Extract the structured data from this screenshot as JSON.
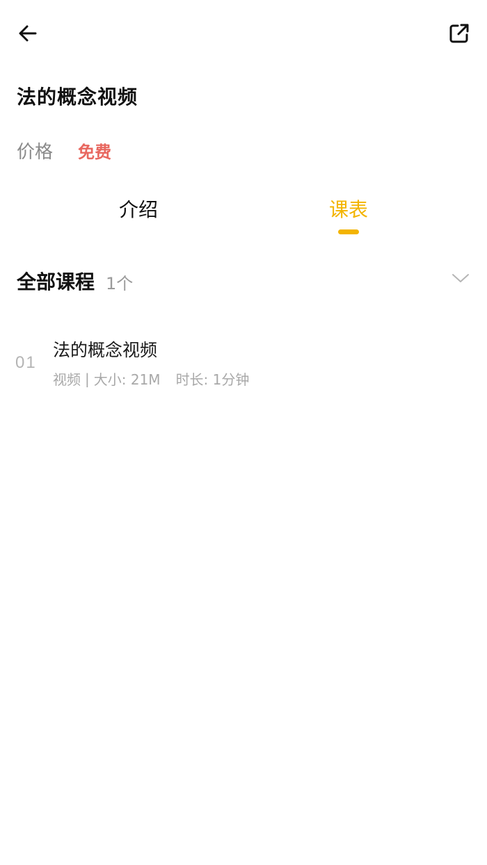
{
  "header": {
    "back_icon": "arrow-left-icon",
    "share_icon": "external-share-icon"
  },
  "course": {
    "title": "法的概念视频",
    "price_label": "价格",
    "price_value": "免费"
  },
  "tabs": [
    {
      "label": "介绍",
      "active": false
    },
    {
      "label": "课表",
      "active": true
    }
  ],
  "section": {
    "title": "全部课程",
    "count": "1个",
    "expand_icon": "chevron-down-icon"
  },
  "lessons": [
    {
      "index": "01",
      "title": "法的概念视频",
      "type": "视频",
      "size": "大小: 21M",
      "duration": "时长: 1分钟"
    }
  ],
  "colors": {
    "accent": "#f3b400",
    "price": "#e8675f",
    "muted": "#a8a8a8"
  }
}
